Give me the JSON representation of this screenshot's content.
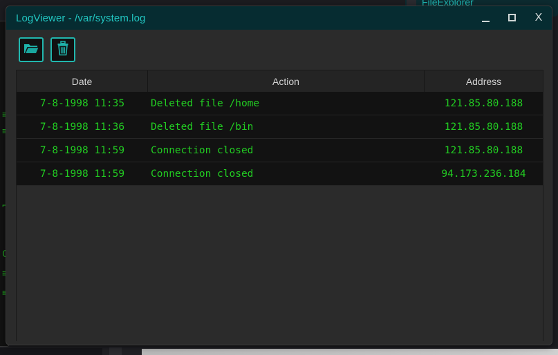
{
  "background": {
    "fileexplorer_title": "FileExplorer",
    "left_window_fragments": [
      "≡",
      "≡",
      "⌐",
      "C",
      "≡",
      "≡"
    ]
  },
  "window": {
    "title": "LogViewer - /var/system.log",
    "controls": {
      "minimize_label": "_",
      "maximize_label": "□",
      "close_label": "X"
    },
    "accent_color": "#22c7c2",
    "titlebar_color": "#062c31"
  },
  "toolbar": {
    "buttons": [
      {
        "name": "open-file-button",
        "icon": "folder-open-icon",
        "label": ""
      },
      {
        "name": "delete-log-button",
        "icon": "trash-icon",
        "label": ""
      }
    ]
  },
  "table": {
    "columns": [
      "Date",
      "Action",
      "Address"
    ],
    "text_color": "#22cc22",
    "rows": [
      {
        "date": "7-8-1998 11:35",
        "action": "Deleted file /home",
        "address": "121.85.80.188"
      },
      {
        "date": "7-8-1998 11:36",
        "action": "Deleted file /bin",
        "address": "121.85.80.188"
      },
      {
        "date": "7-8-1998 11:59",
        "action": "Connection closed",
        "address": "121.85.80.188"
      },
      {
        "date": "7-8-1998 11:59",
        "action": "Connection closed",
        "address": "94.173.236.184"
      }
    ]
  }
}
